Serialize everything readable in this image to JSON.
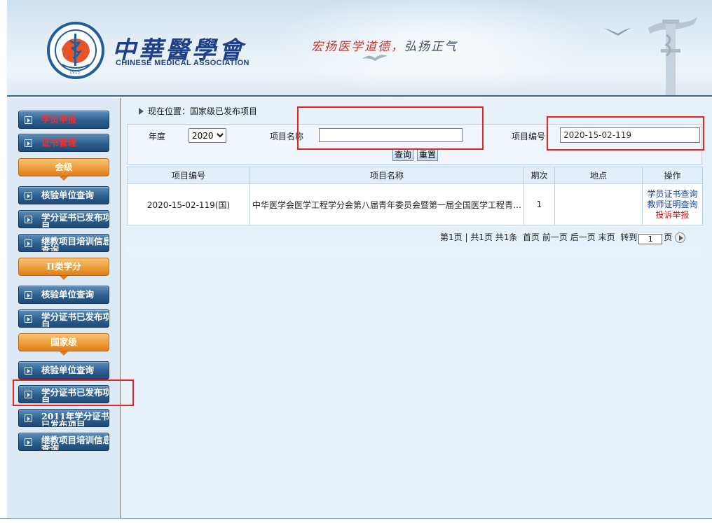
{
  "header": {
    "logo_cn": "中華醫學會",
    "logo_en": "CHINESE MEDICAL ASSOCIATION",
    "emblem_top_text": "中华医学会",
    "emblem_bottom_text": "CHINESE MEDICAL ASSOCIATION",
    "emblem_year": "1915",
    "slogan_part1": "宏扬医学道德，",
    "slogan_part2": "弘扬正气"
  },
  "sidebar": {
    "items": [
      {
        "type": "button",
        "label": "学员申报",
        "red": true
      },
      {
        "type": "button",
        "label": "证书管理",
        "red": true
      },
      {
        "type": "category",
        "label": "会级"
      },
      {
        "type": "button",
        "label": "核验单位查询"
      },
      {
        "type": "button",
        "label": "学分证书已发布项目"
      },
      {
        "type": "button",
        "label": "继教项目培训信息查询"
      },
      {
        "type": "category",
        "label": "II类学分"
      },
      {
        "type": "button",
        "label": "核验单位查询"
      },
      {
        "type": "button",
        "label": "学分证书已发布项目"
      },
      {
        "type": "category",
        "label": "国家级"
      },
      {
        "type": "button",
        "label": "核验单位查询"
      },
      {
        "type": "button",
        "label": "学分证书已发布项目"
      },
      {
        "type": "button",
        "label": "2011年学分证书已发布项目"
      },
      {
        "type": "button",
        "label": "继教项目培训信息查询"
      }
    ]
  },
  "breadcrumb": "现在位置：国家级已发布项目",
  "search": {
    "year_label": "年度",
    "year_value": "2020",
    "name_label": "项目名称",
    "name_value": "",
    "code_label": "项目编号",
    "code_value": "2020-15-02-119",
    "query_btn": "查询",
    "reset_btn": "重置"
  },
  "table": {
    "headers": [
      "项目编号",
      "项目名称",
      "期次",
      "地点",
      "操作"
    ],
    "rows": [
      {
        "code": "2020-15-02-119(国)",
        "name": "中华医学会医学工程学分会第八届青年委员会暨第一届全国医学工程青年论坛",
        "session": "1",
        "location": "",
        "ops": [
          "学员证书查询",
          "教师证明查询",
          "投诉举报"
        ]
      }
    ]
  },
  "pager": {
    "info": "第1页 | 共1页 共1条",
    "first": "首页",
    "prev": "前一页",
    "next": "后一页",
    "last": "末页",
    "goto_label": "转到",
    "page_value": "1",
    "page_suffix": "页"
  },
  "colors": {
    "sidebar_button": "#2d5f8e",
    "category_button": "#ec9a33",
    "annotation_red": "#e8231f",
    "link_blue": "#1546a8"
  }
}
